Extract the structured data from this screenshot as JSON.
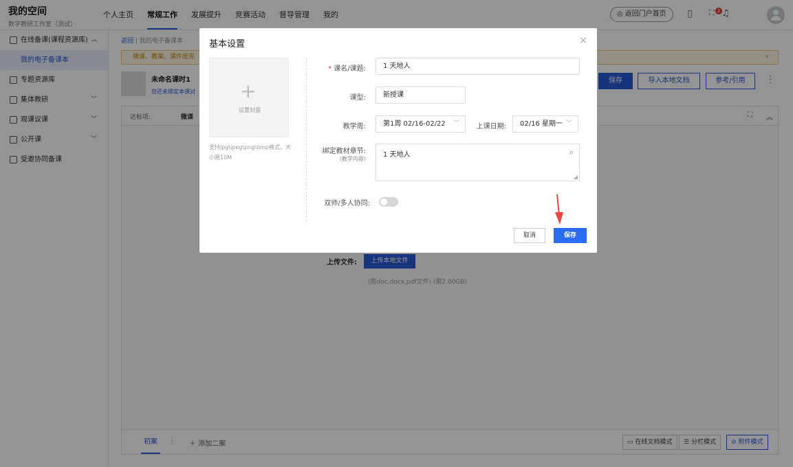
{
  "header": {
    "title": "我的空间",
    "subtitle": "数字教研工作室（测试）",
    "nav": [
      "个人主页",
      "常规工作",
      "发展提升",
      "竞赛活动",
      "督导管理",
      "我的"
    ],
    "portal_label": "返回门户首页",
    "notification_count": "2"
  },
  "sidebar": {
    "items": [
      {
        "label": "在线备课(课程资源库)",
        "expanded": true
      },
      {
        "label": "我的电子备课本"
      },
      {
        "label": "专题资源库"
      },
      {
        "label": "集体教研"
      },
      {
        "label": "观课议课"
      },
      {
        "label": "公开课"
      },
      {
        "label": "受邀协同备课"
      }
    ]
  },
  "main": {
    "back": "返回",
    "breadcrumb": "我的电子备课本",
    "notice": "微课、教案、课件是完",
    "lesson_name": "未命名课时1",
    "lesson_sub": "您还未绑定本课对",
    "save": "保存",
    "import_local": "导入本地文档",
    "reference": "参考/引用",
    "target_label": "达标项:",
    "target_value": "微课",
    "upload_label": "上传文件:",
    "upload_button": "上传本地文件",
    "upload_hint": "(限doc,docx,pdf文件)  (限2.00GB)",
    "draft_tab": "初案",
    "add_second": "添加二案",
    "modes": [
      "在线文档模式",
      "分栏模式",
      "附件模式"
    ]
  },
  "modal": {
    "title": "基本设置",
    "cover_label": "设置封面",
    "cover_hint": "支持jpg\\jpeg\\png\\bmp格式，大小限10M",
    "course_label": "课名/课题:",
    "course_value": "1 天地人",
    "type_label": "课型:",
    "type_value": "新授课",
    "week_label": "教学周:",
    "week_value": "第1周 02/16-02/22",
    "date_label": "上课日期:",
    "date_value": "02/16 星期一",
    "chapter_label": "绑定教材章节:",
    "chapter_sub": "(教学内容)",
    "chapter_value": "1 天地人",
    "coop_label": "双师/多人协同:",
    "cancel": "取消",
    "ok": "保存"
  },
  "colors": {
    "primary": "#2a5bd7",
    "annotation_arrow": "#f04545"
  }
}
